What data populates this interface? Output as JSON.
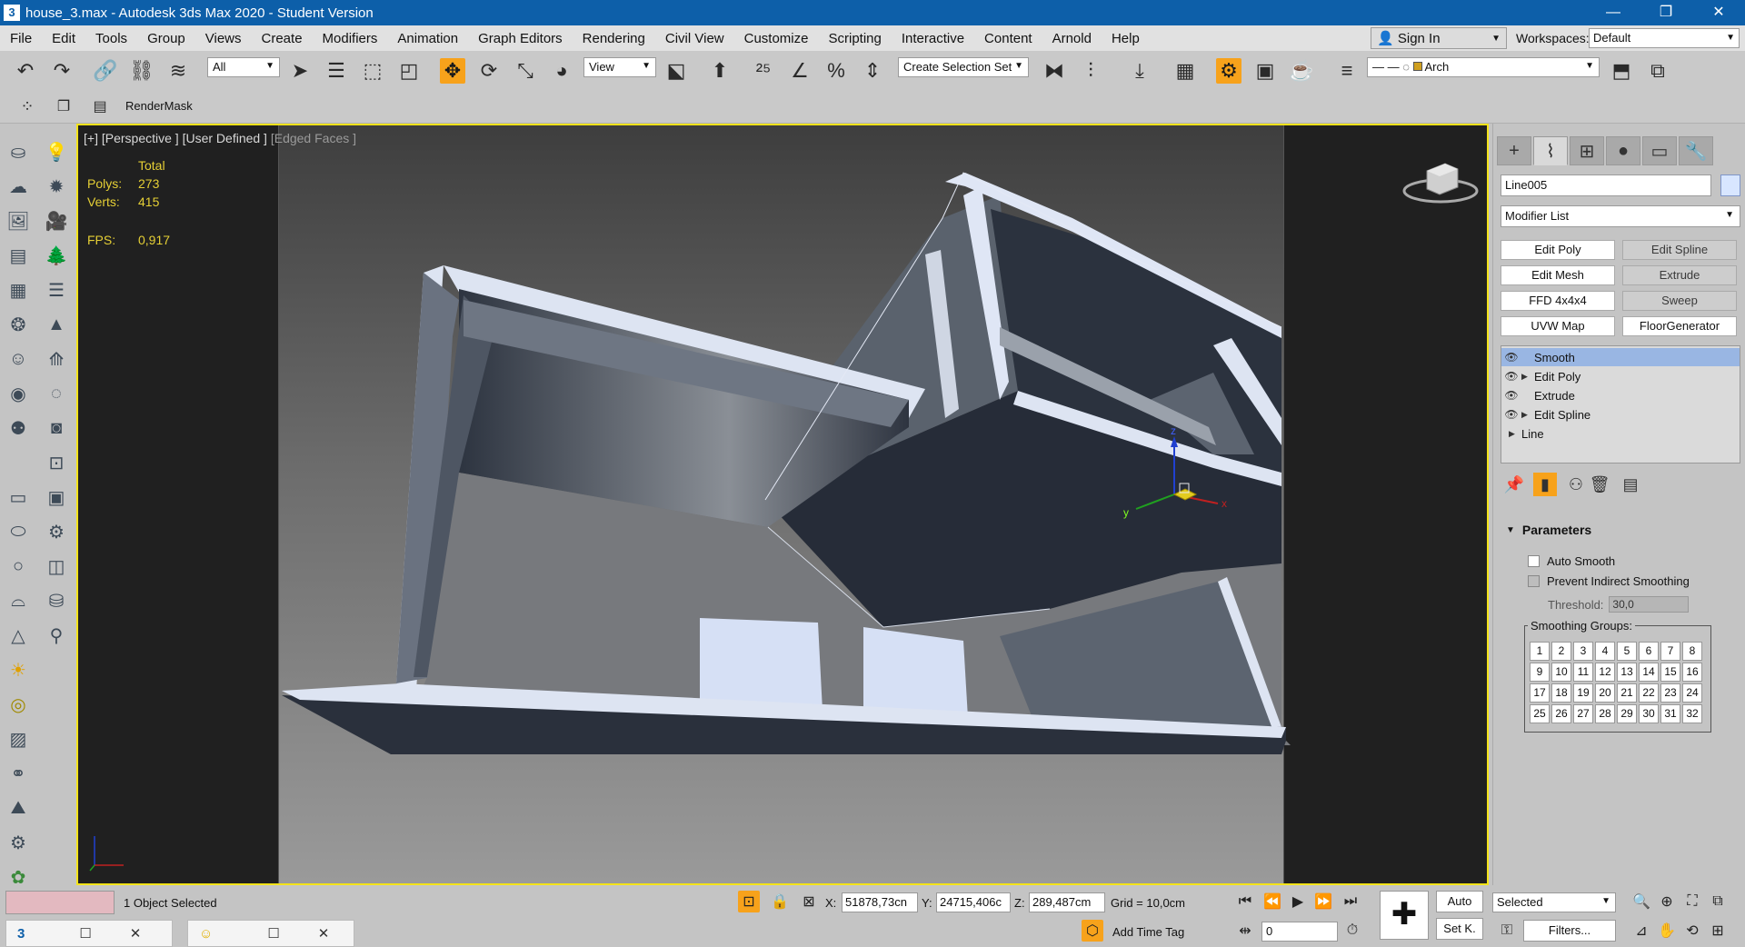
{
  "window": {
    "title": "house_3.max - Autodesk 3ds Max 2020 - Student Version",
    "app_icon": "3",
    "minimize": "—",
    "restore": "❐",
    "close": "✕"
  },
  "menu": {
    "items": [
      "File",
      "Edit",
      "Tools",
      "Group",
      "Views",
      "Create",
      "Modifiers",
      "Animation",
      "Graph Editors",
      "Rendering",
      "Civil View",
      "Customize",
      "Scripting",
      "Interactive",
      "Content",
      "Arnold",
      "Help"
    ],
    "sign_in": "Sign In",
    "workspaces_label": "Workspaces:",
    "workspace_value": "Default"
  },
  "toolbar": {
    "filter_value": "All",
    "coord_system": "View",
    "selection_set": "Create Selection Set",
    "layer_value": "Arch"
  },
  "toolbar2": {
    "render_mask": "RenderMask"
  },
  "viewport": {
    "label_plus": "[+]",
    "label_view": "[Perspective ]",
    "label_shading": "[User Defined ]",
    "label_edges": "[Edged Faces ]",
    "stats": {
      "total_label": "Total",
      "polys_label": "Polys:",
      "polys_value": "273",
      "verts_label": "Verts:",
      "verts_value": "415",
      "fps_label": "FPS:",
      "fps_value": "0,917"
    },
    "gizmo_x": "x",
    "gizmo_y": "y",
    "gizmo_z": "z",
    "accent": "#f3e31a"
  },
  "command_panel": {
    "object_name": "Line005",
    "modifier_list": "Modifier List",
    "modifier_buttons": [
      "Edit Poly",
      "Edit Spline",
      "Edit Mesh",
      "Extrude",
      "FFD 4x4x4",
      "Sweep",
      "UVW Map",
      "FloorGenerator"
    ],
    "stack": [
      {
        "label": "Smooth",
        "selected": true,
        "eye": true,
        "expand": false
      },
      {
        "label": "Edit Poly",
        "selected": false,
        "eye": true,
        "expand": true
      },
      {
        "label": "Extrude",
        "selected": false,
        "eye": true,
        "expand": false
      },
      {
        "label": "Edit Spline",
        "selected": false,
        "eye": true,
        "expand": true
      },
      {
        "label": "Line",
        "selected": false,
        "eye": false,
        "expand": true
      }
    ],
    "parameters_title": "Parameters",
    "auto_smooth": "Auto Smooth",
    "prevent_indirect": "Prevent Indirect Smoothing",
    "threshold_label": "Threshold:",
    "threshold_value": "30,0",
    "smoothing_groups_label": "Smoothing Groups:",
    "smoothing_groups": [
      "1",
      "2",
      "3",
      "4",
      "5",
      "6",
      "7",
      "8",
      "9",
      "10",
      "11",
      "12",
      "13",
      "14",
      "15",
      "16",
      "17",
      "18",
      "19",
      "20",
      "21",
      "22",
      "23",
      "24",
      "25",
      "26",
      "27",
      "28",
      "29",
      "30",
      "31",
      "32"
    ]
  },
  "status": {
    "selection_text": "1 Object Selected",
    "x_label": "X:",
    "x_value": "51878,73cn",
    "y_label": "Y:",
    "y_value": "24715,406c",
    "z_label": "Z:",
    "z_value": "289,487cm",
    "grid": "Grid = 10,0cm",
    "add_time_tag": "Add Time Tag",
    "frame_value": "0",
    "auto_label": "Auto",
    "set_key_label": "Set K.",
    "key_filter": "Selected",
    "filters_label": "Filters..."
  }
}
